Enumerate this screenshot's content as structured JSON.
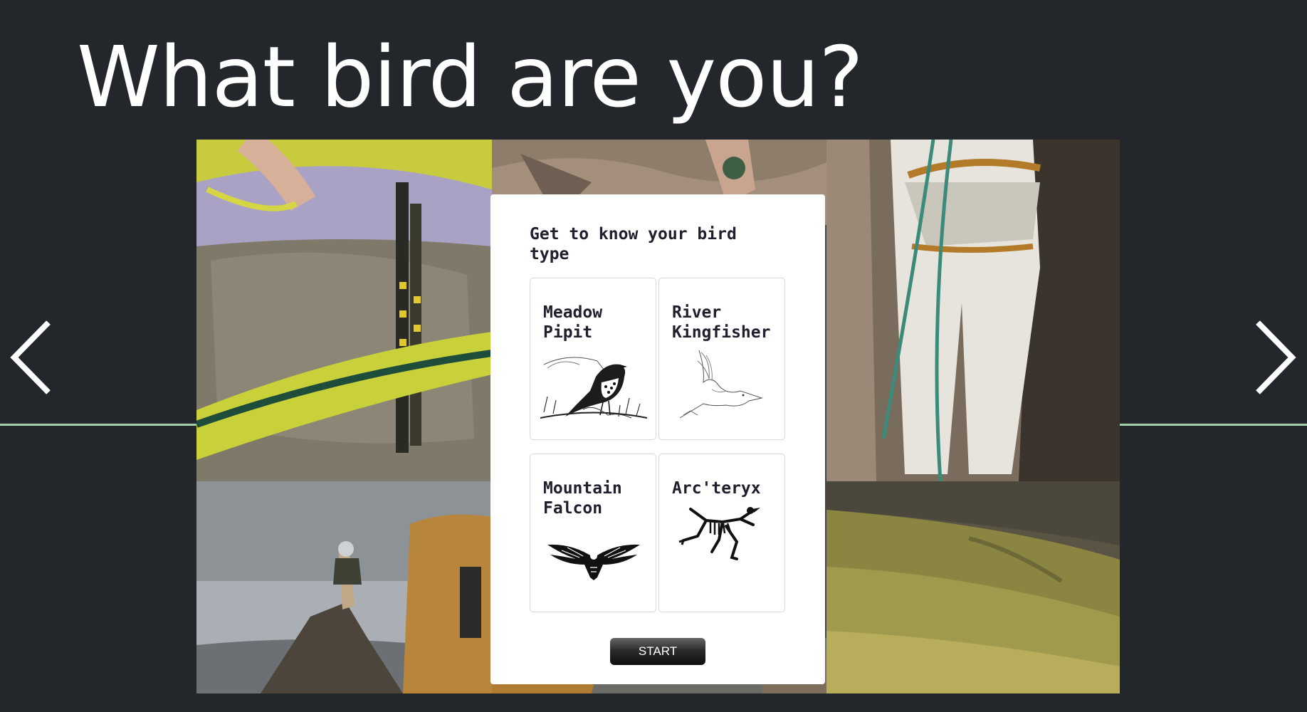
{
  "page": {
    "title": "What bird are you?"
  },
  "navigation": {
    "prev_icon": "chevron-left-icon",
    "next_icon": "chevron-right-icon"
  },
  "collage": {
    "photos": [
      "climber-harness-closeup",
      "rock-climber-top",
      "climber-white-pants-rope",
      "hiker-on-rocky-peak",
      "hiker-yellow-jacket",
      "grassy-mountain-slope"
    ]
  },
  "quiz": {
    "heading": "Get to know your bird type",
    "options": [
      {
        "name": "Meadow\nPipit",
        "icon": "pipit-illustration-icon"
      },
      {
        "name": "River\nKingfisher",
        "icon": "kingfisher-sketch-icon"
      },
      {
        "name": "Mountain\nFalcon",
        "icon": "falcon-icon"
      },
      {
        "name": "Arc'teryx",
        "icon": "arcteryx-logo-icon"
      }
    ],
    "start_label": "START"
  },
  "colors": {
    "background": "#23272b",
    "divider": "#9fd0a8",
    "card": "#ffffff",
    "text_dark": "#1f1f2e"
  }
}
